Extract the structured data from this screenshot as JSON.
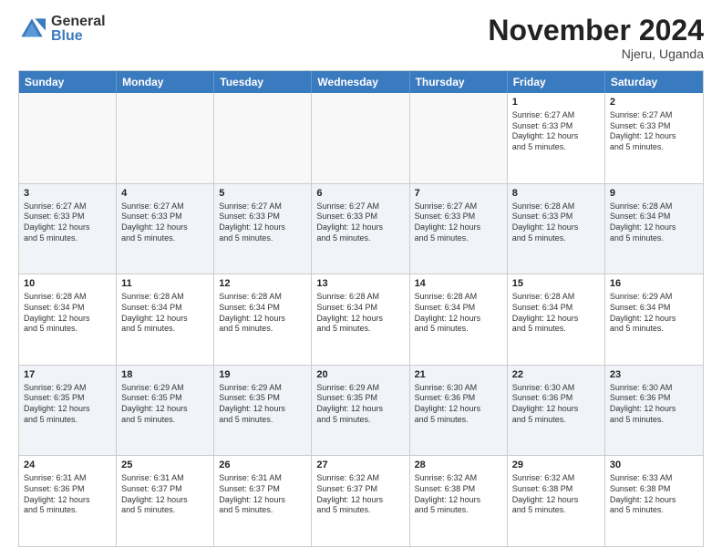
{
  "logo": {
    "general": "General",
    "blue": "Blue"
  },
  "title": "November 2024",
  "location": "Njeru, Uganda",
  "header_days": [
    "Sunday",
    "Monday",
    "Tuesday",
    "Wednesday",
    "Thursday",
    "Friday",
    "Saturday"
  ],
  "rows": [
    [
      {
        "day": "",
        "empty": true
      },
      {
        "day": "",
        "empty": true
      },
      {
        "day": "",
        "empty": true
      },
      {
        "day": "",
        "empty": true
      },
      {
        "day": "",
        "empty": true
      },
      {
        "day": "1",
        "text": "Sunrise: 6:27 AM\nSunset: 6:33 PM\nDaylight: 12 hours\nand 5 minutes."
      },
      {
        "day": "2",
        "text": "Sunrise: 6:27 AM\nSunset: 6:33 PM\nDaylight: 12 hours\nand 5 minutes."
      }
    ],
    [
      {
        "day": "3",
        "text": "Sunrise: 6:27 AM\nSunset: 6:33 PM\nDaylight: 12 hours\nand 5 minutes."
      },
      {
        "day": "4",
        "text": "Sunrise: 6:27 AM\nSunset: 6:33 PM\nDaylight: 12 hours\nand 5 minutes."
      },
      {
        "day": "5",
        "text": "Sunrise: 6:27 AM\nSunset: 6:33 PM\nDaylight: 12 hours\nand 5 minutes."
      },
      {
        "day": "6",
        "text": "Sunrise: 6:27 AM\nSunset: 6:33 PM\nDaylight: 12 hours\nand 5 minutes."
      },
      {
        "day": "7",
        "text": "Sunrise: 6:27 AM\nSunset: 6:33 PM\nDaylight: 12 hours\nand 5 minutes."
      },
      {
        "day": "8",
        "text": "Sunrise: 6:28 AM\nSunset: 6:33 PM\nDaylight: 12 hours\nand 5 minutes."
      },
      {
        "day": "9",
        "text": "Sunrise: 6:28 AM\nSunset: 6:34 PM\nDaylight: 12 hours\nand 5 minutes."
      }
    ],
    [
      {
        "day": "10",
        "text": "Sunrise: 6:28 AM\nSunset: 6:34 PM\nDaylight: 12 hours\nand 5 minutes."
      },
      {
        "day": "11",
        "text": "Sunrise: 6:28 AM\nSunset: 6:34 PM\nDaylight: 12 hours\nand 5 minutes."
      },
      {
        "day": "12",
        "text": "Sunrise: 6:28 AM\nSunset: 6:34 PM\nDaylight: 12 hours\nand 5 minutes."
      },
      {
        "day": "13",
        "text": "Sunrise: 6:28 AM\nSunset: 6:34 PM\nDaylight: 12 hours\nand 5 minutes."
      },
      {
        "day": "14",
        "text": "Sunrise: 6:28 AM\nSunset: 6:34 PM\nDaylight: 12 hours\nand 5 minutes."
      },
      {
        "day": "15",
        "text": "Sunrise: 6:28 AM\nSunset: 6:34 PM\nDaylight: 12 hours\nand 5 minutes."
      },
      {
        "day": "16",
        "text": "Sunrise: 6:29 AM\nSunset: 6:34 PM\nDaylight: 12 hours\nand 5 minutes."
      }
    ],
    [
      {
        "day": "17",
        "text": "Sunrise: 6:29 AM\nSunset: 6:35 PM\nDaylight: 12 hours\nand 5 minutes."
      },
      {
        "day": "18",
        "text": "Sunrise: 6:29 AM\nSunset: 6:35 PM\nDaylight: 12 hours\nand 5 minutes."
      },
      {
        "day": "19",
        "text": "Sunrise: 6:29 AM\nSunset: 6:35 PM\nDaylight: 12 hours\nand 5 minutes."
      },
      {
        "day": "20",
        "text": "Sunrise: 6:29 AM\nSunset: 6:35 PM\nDaylight: 12 hours\nand 5 minutes."
      },
      {
        "day": "21",
        "text": "Sunrise: 6:30 AM\nSunset: 6:36 PM\nDaylight: 12 hours\nand 5 minutes."
      },
      {
        "day": "22",
        "text": "Sunrise: 6:30 AM\nSunset: 6:36 PM\nDaylight: 12 hours\nand 5 minutes."
      },
      {
        "day": "23",
        "text": "Sunrise: 6:30 AM\nSunset: 6:36 PM\nDaylight: 12 hours\nand 5 minutes."
      }
    ],
    [
      {
        "day": "24",
        "text": "Sunrise: 6:31 AM\nSunset: 6:36 PM\nDaylight: 12 hours\nand 5 minutes."
      },
      {
        "day": "25",
        "text": "Sunrise: 6:31 AM\nSunset: 6:37 PM\nDaylight: 12 hours\nand 5 minutes."
      },
      {
        "day": "26",
        "text": "Sunrise: 6:31 AM\nSunset: 6:37 PM\nDaylight: 12 hours\nand 5 minutes."
      },
      {
        "day": "27",
        "text": "Sunrise: 6:32 AM\nSunset: 6:37 PM\nDaylight: 12 hours\nand 5 minutes."
      },
      {
        "day": "28",
        "text": "Sunrise: 6:32 AM\nSunset: 6:38 PM\nDaylight: 12 hours\nand 5 minutes."
      },
      {
        "day": "29",
        "text": "Sunrise: 6:32 AM\nSunset: 6:38 PM\nDaylight: 12 hours\nand 5 minutes."
      },
      {
        "day": "30",
        "text": "Sunrise: 6:33 AM\nSunset: 6:38 PM\nDaylight: 12 hours\nand 5 minutes."
      }
    ]
  ]
}
